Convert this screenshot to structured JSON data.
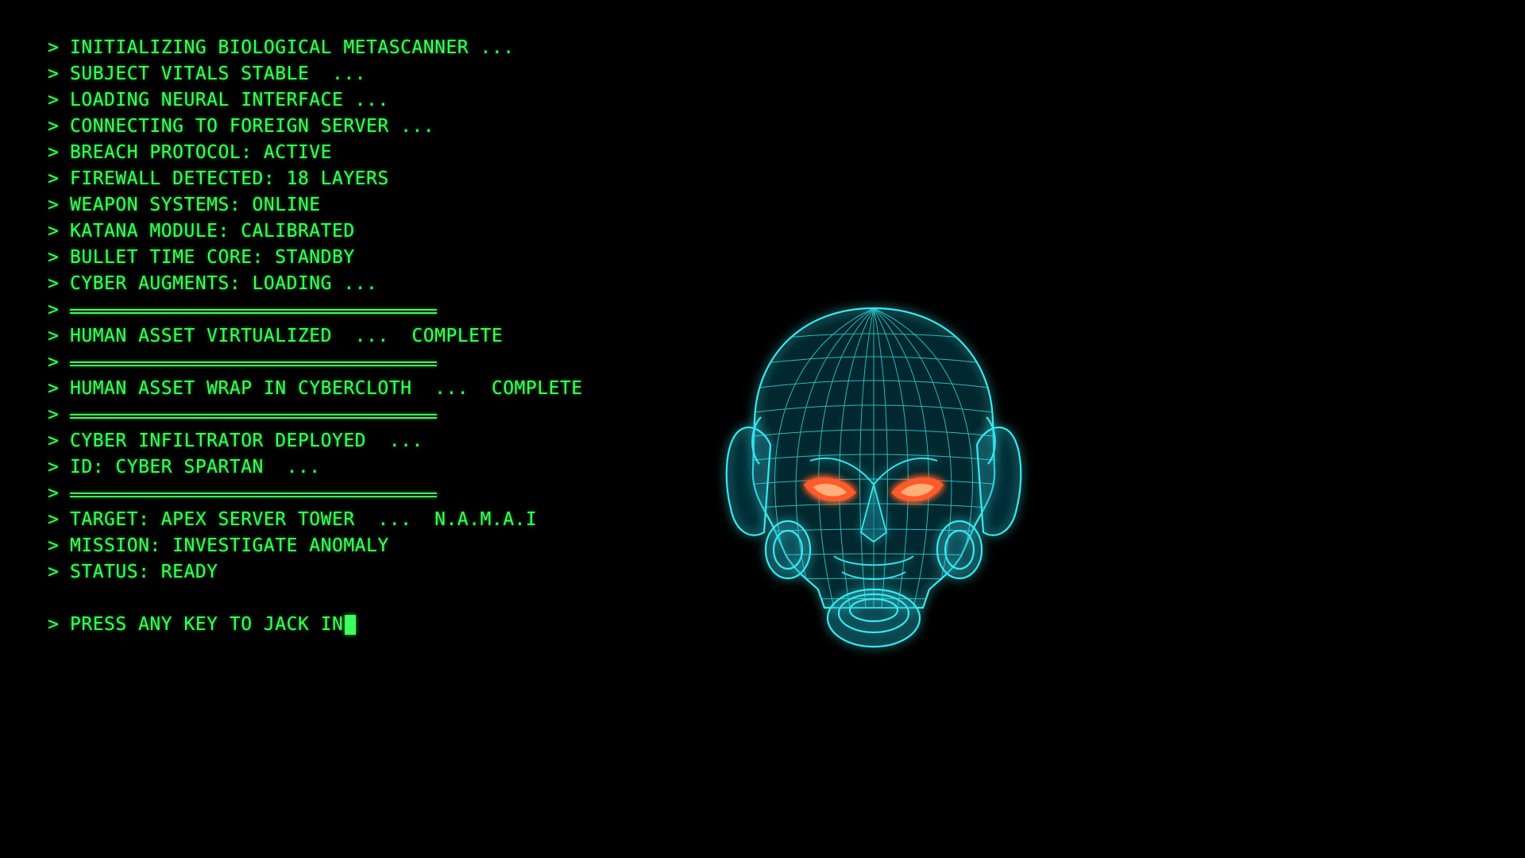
{
  "terminal": {
    "prompt_symbol": ">",
    "lines": [
      "INITIALIZING BIOLOGICAL METASCANNER ...",
      "SUBJECT VITALS STABLE  ...",
      "LOADING NEURAL INTERFACE ...",
      "CONNECTING TO FOREIGN SERVER ...",
      "BREACH PROTOCOL: ACTIVE",
      "FIREWALL DETECTED: 18 LAYERS",
      "WEAPON SYSTEMS: ONLINE",
      "KATANA MODULE: CALIBRATED",
      "BULLET TIME CORE: STANDBY",
      "CYBER AUGMENTS: LOADING ..."
    ],
    "asset_virtualized": "HUMAN ASSET VIRTUALIZED  ...  COMPLETE",
    "asset_wrap": "HUMAN ASSET WRAP IN CYBERCLOTH  ...  COMPLETE",
    "infiltrator_deployed": "CYBER INFILTRATOR DEPLOYED  ...",
    "id_line": "ID: CYBER SPARTAN  ...",
    "target": "TARGET: APEX SERVER TOWER  ...  N.A.M.A.I",
    "mission": "MISSION: INVESTIGATE ANOMALY",
    "status": "STATUS: READY",
    "press_key": "PRESS ANY KEY TO JACK IN"
  },
  "colors": {
    "terminal_text": "#3cff5a",
    "background": "#000000",
    "helmet_wireframe": "#38e8f0",
    "helmet_eyes": "#ff5a2a"
  },
  "icons": {
    "helmet": "wireframe-cyber-helmet-icon"
  }
}
